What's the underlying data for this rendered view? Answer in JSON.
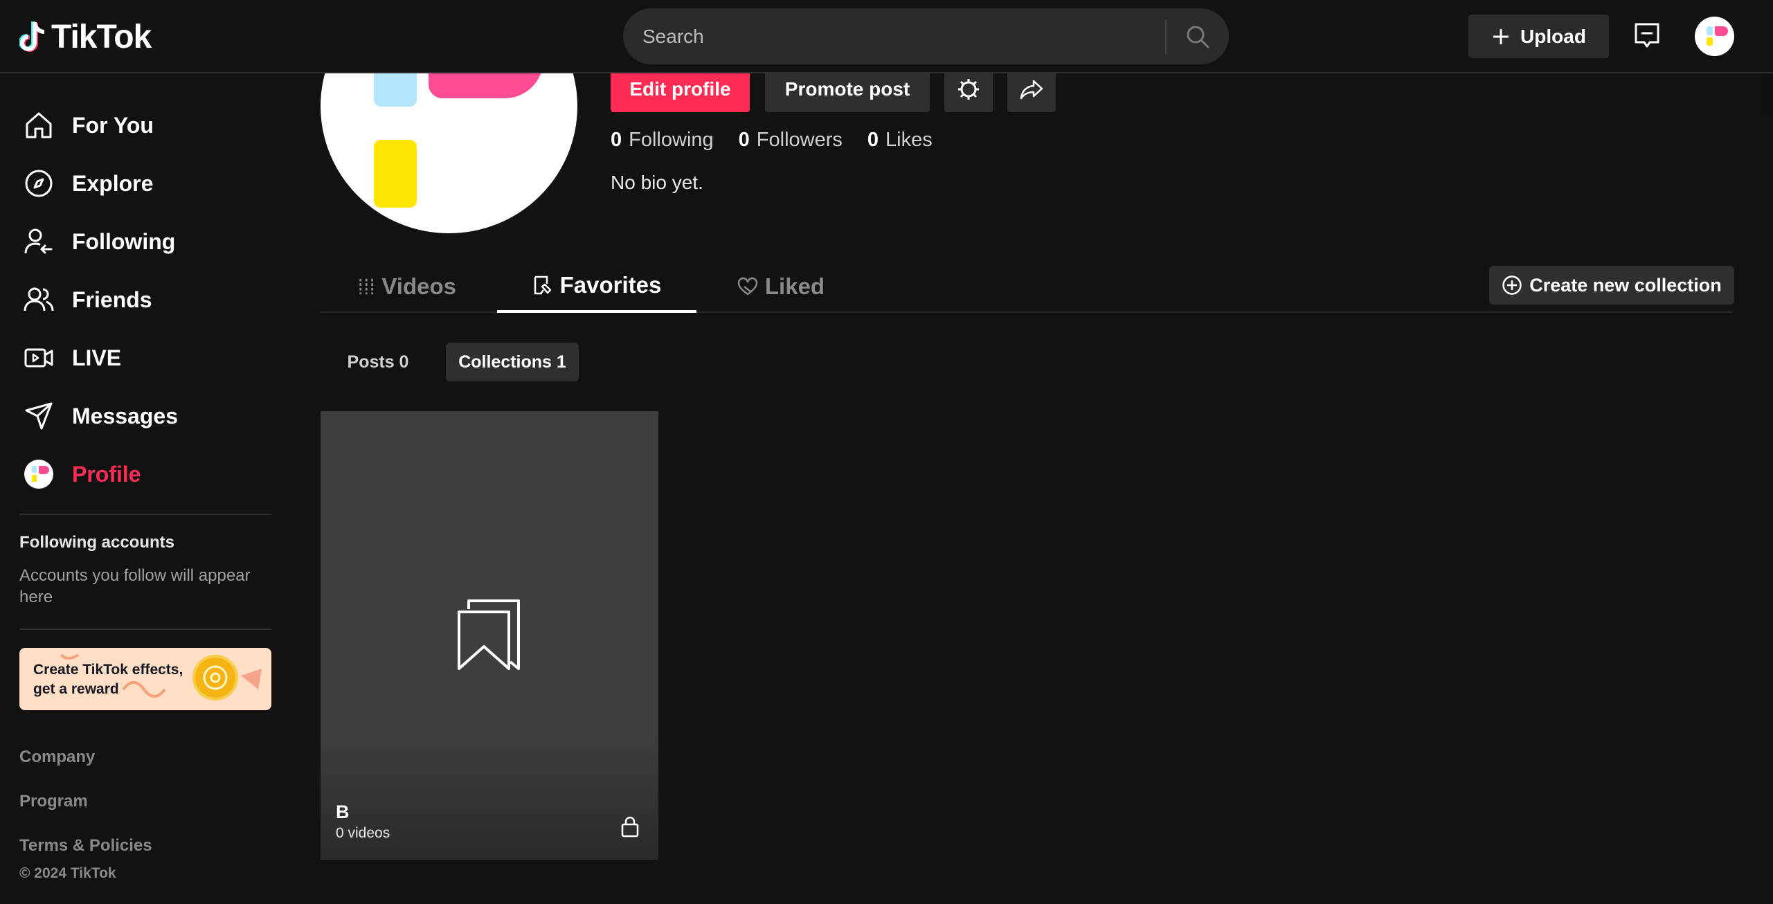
{
  "header": {
    "logo_text": "TikTok",
    "search_placeholder": "Search",
    "upload_label": "Upload"
  },
  "sidebar": {
    "nav": [
      {
        "label": "For You",
        "icon": "home-icon"
      },
      {
        "label": "Explore",
        "icon": "compass-icon"
      },
      {
        "label": "Following",
        "icon": "following-icon"
      },
      {
        "label": "Friends",
        "icon": "friends-icon"
      },
      {
        "label": "LIVE",
        "icon": "live-icon"
      },
      {
        "label": "Messages",
        "icon": "send-icon"
      },
      {
        "label": "Profile",
        "icon": "avatar"
      }
    ],
    "following_title": "Following accounts",
    "following_desc": "Accounts you follow will appear here",
    "promo_text_line1": "Create TikTok effects,",
    "promo_text_line2": "get a reward",
    "footer_links": [
      "Company",
      "Program",
      "Terms & Policies"
    ],
    "copyright": "© 2024 TikTok"
  },
  "profile": {
    "edit_label": "Edit profile",
    "promote_label": "Promote post",
    "stats": [
      {
        "value": "0",
        "label": "Following"
      },
      {
        "value": "0",
        "label": "Followers"
      },
      {
        "value": "0",
        "label": "Likes"
      }
    ],
    "bio": "No bio yet."
  },
  "tabs": [
    {
      "label": "Videos",
      "active": false
    },
    {
      "label": "Favorites",
      "active": true
    },
    {
      "label": "Liked",
      "active": false
    }
  ],
  "create_collection_label": "Create new collection",
  "subtabs": [
    {
      "label": "Posts",
      "count": "0"
    },
    {
      "label": "Collections",
      "count": "1"
    }
  ],
  "subtab_labels": [
    "Posts 0",
    "Collections 1"
  ],
  "collection": {
    "title": "B",
    "subtitle": "0 videos"
  },
  "colors": {
    "accent": "#fe2c55",
    "background": "#121212",
    "surface": "#2f2f2f"
  }
}
